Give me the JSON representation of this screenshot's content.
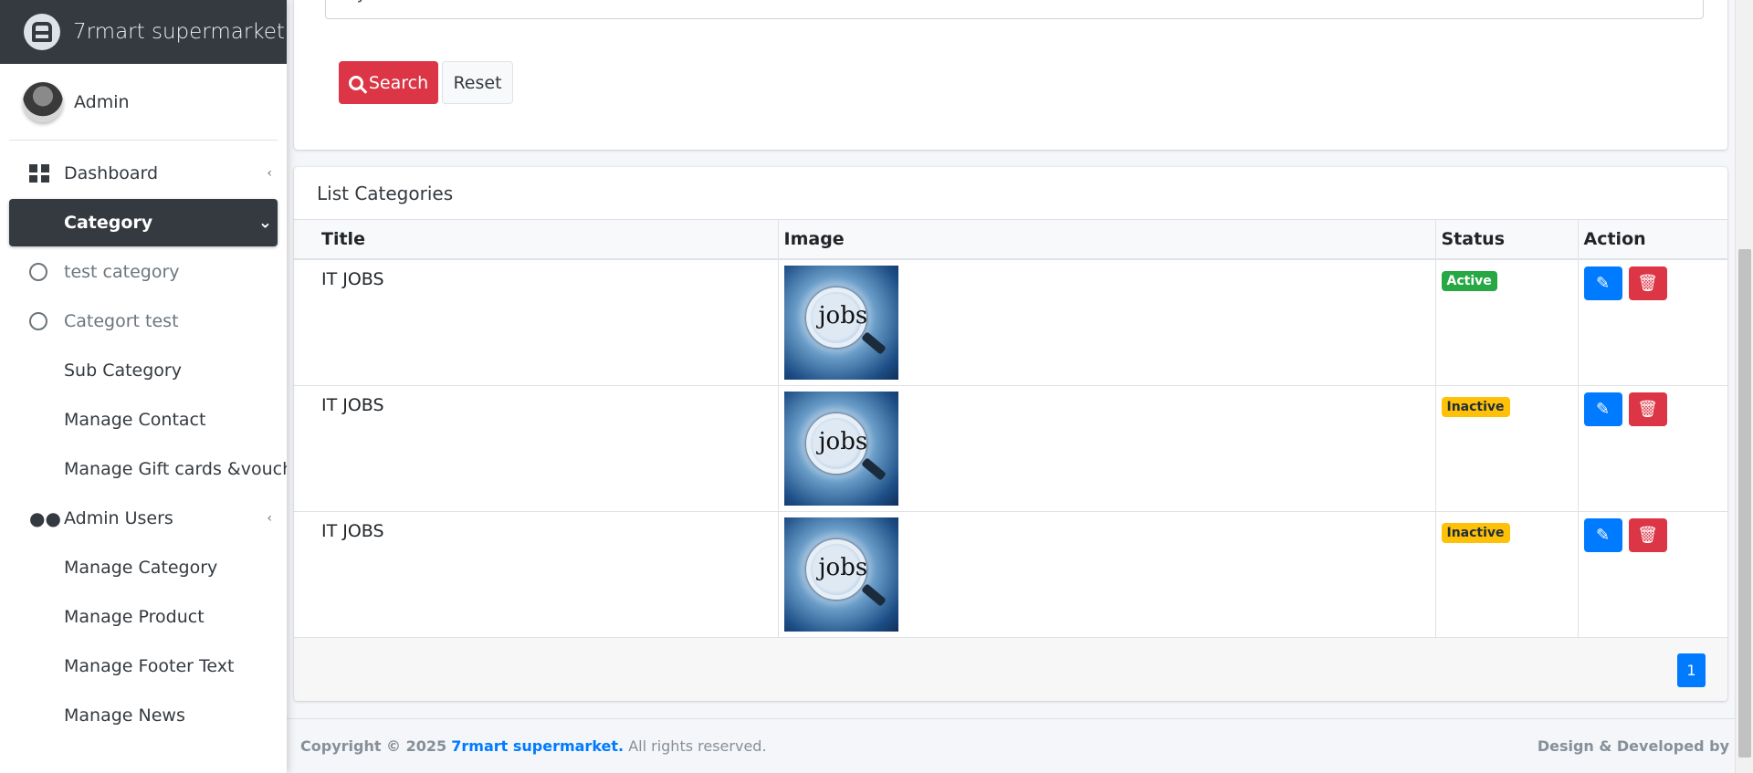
{
  "brand": {
    "name": "7rmart supermarket"
  },
  "user": {
    "name": "Admin"
  },
  "sidebar": {
    "items": [
      {
        "label": "Dashboard"
      },
      {
        "label": "Category"
      },
      {
        "label": "test category"
      },
      {
        "label": "Categort test"
      },
      {
        "label": "Sub Category"
      },
      {
        "label": "Manage Contact"
      },
      {
        "label": "Manage Gift cards &voucher"
      },
      {
        "label": "Admin Users"
      },
      {
        "label": "Manage Category"
      },
      {
        "label": "Manage Product"
      },
      {
        "label": "Manage Footer Text"
      },
      {
        "label": "Manage News"
      }
    ]
  },
  "search": {
    "value": "IT JOBS",
    "search_label": "Search",
    "reset_label": "Reset"
  },
  "list": {
    "title": "List Categories",
    "columns": [
      "Title",
      "Image",
      "Status",
      "Action"
    ],
    "rows": [
      {
        "title": "IT JOBS",
        "image_text": "jobs",
        "status": "Active"
      },
      {
        "title": "IT JOBS",
        "image_text": "jobs",
        "status": "Inactive"
      },
      {
        "title": "IT JOBS",
        "image_text": "jobs",
        "status": "Inactive"
      }
    ],
    "page": "1"
  },
  "footer": {
    "copyright_prefix": "Copyright © 2025",
    "brand": "7rmart supermarket.",
    "rights": "All rights reserved.",
    "design": "Design & Developed by"
  },
  "colors": {
    "sidebar_dark": "#343a40",
    "primary": "#007bff",
    "danger": "#dc3545",
    "success": "#28a745",
    "warning": "#ffc107"
  }
}
